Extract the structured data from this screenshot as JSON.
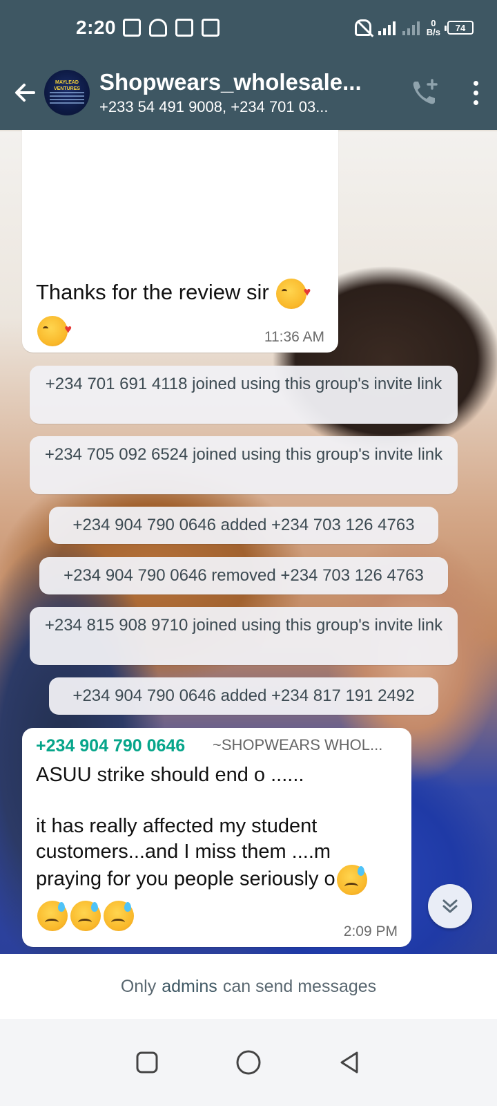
{
  "status_bar": {
    "time": "2:20",
    "net_speed_value": "0",
    "net_speed_unit": "B/s",
    "battery": "74"
  },
  "header": {
    "group_name": "Shopwears_wholesale...",
    "participants": "+233 54 491 9008, +234 701 03...",
    "avatar_text": "MAYLEAD VENTURES"
  },
  "messages": [
    {
      "text": "Thanks for the review sir",
      "time": "11:36 AM"
    },
    {
      "sender": "+234 904 790 0646",
      "pushname": "~SHOPWEARS WHOL...",
      "line1": "ASUU strike should end o ......",
      "line2": "it has really affected my student customers...and I miss them ....m praying for you people seriously o",
      "time": "2:09 PM"
    }
  ],
  "system_messages": [
    "+234 701 691 4118 joined using this group's invite link",
    "+234 705 092 6524 joined using this group's invite link",
    "+234 904 790 0646 added +234 703 126 4763",
    "+234 904 790 0646 removed +234 703 126 4763",
    "+234 815 908 9710 joined using this group's invite link",
    "+234 904 790 0646 added +234 817 191 2492"
  ],
  "footer": {
    "prefix": "Only",
    "link": "admins",
    "suffix": "can send messages"
  },
  "icons": {
    "back": "back-arrow-icon",
    "call": "add-call-icon",
    "menu": "more-options-icon",
    "scroll": "double-chevron-down-icon",
    "nav_recents": "square-icon",
    "nav_home": "circle-icon",
    "nav_back": "triangle-icon"
  },
  "colors": {
    "header_bg": "#3e5763",
    "sender_green": "#06a58a",
    "system_bubble": "#f0f0f4"
  }
}
